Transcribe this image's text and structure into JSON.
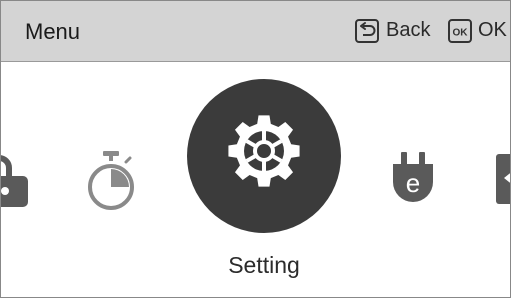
{
  "header": {
    "title": "Menu",
    "back_label": "Back",
    "ok_icon_text": "OK",
    "ok_label": "OK"
  },
  "carousel": {
    "items": [
      {
        "icon": "lock-icon"
      },
      {
        "icon": "timer-icon"
      },
      {
        "icon": "gear-icon",
        "label": "Setting",
        "selected": true
      },
      {
        "icon": "eco-plug-icon",
        "glyph": "e"
      },
      {
        "icon": "usb-icon"
      }
    ]
  },
  "colors": {
    "header_bg": "#d4d4d4",
    "icon_gray": "#5a5a5a",
    "light_gray": "#8a8a8a",
    "selected_circle": "#3b3b3b",
    "text": "#1a1a1a"
  }
}
